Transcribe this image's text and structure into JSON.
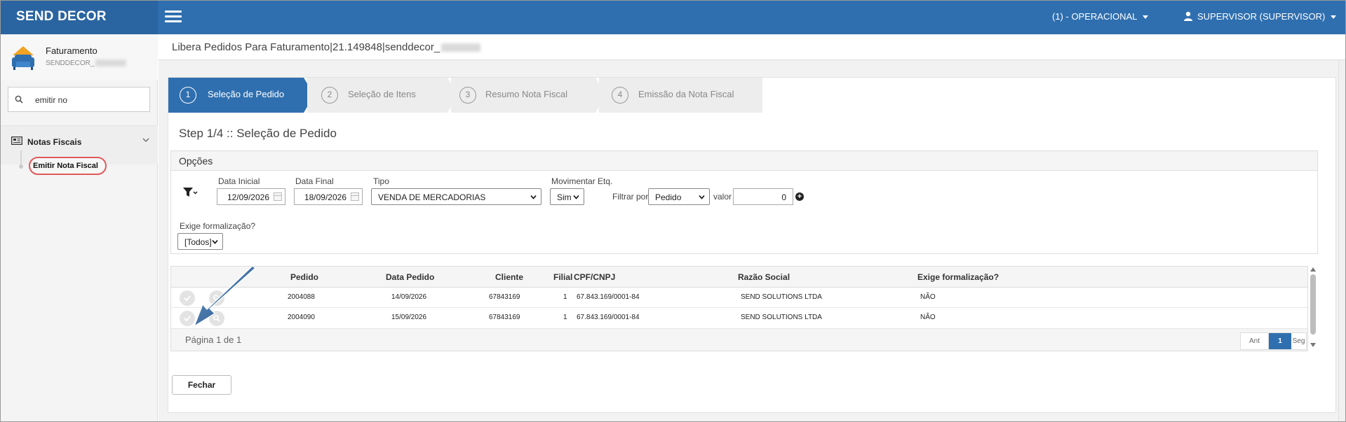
{
  "topbar": {
    "brand": "SEND DECOR",
    "unit": "(1) - OPERACIONAL",
    "user": "SUPERVISOR (SUPERVISOR)",
    "color": "#2f6faf"
  },
  "sidebar": {
    "module_title": "Faturamento",
    "module_sub": "SENDDECOR_",
    "search_value": "emitir no",
    "menu_group": "Notas Fiscais",
    "menu_item": "Emitir Nota Fiscal"
  },
  "page": {
    "title": "Libera Pedidos Para Faturamento|21.149848|senddecor_"
  },
  "wizard": {
    "steps": [
      {
        "num": "1",
        "label": "Seleção de Pedido"
      },
      {
        "num": "2",
        "label": "Seleção de Itens"
      },
      {
        "num": "3",
        "label": "Resumo Nota Fiscal"
      },
      {
        "num": "4",
        "label": "Emissão da Nota Fiscal"
      }
    ],
    "step_title": "Step 1/4 :: Seleção de Pedido"
  },
  "options": {
    "header": "Opções",
    "data_inicial_label": "Data Inicial",
    "data_inicial": "12/09/2026",
    "data_final_label": "Data Final",
    "data_final": "18/09/2026",
    "tipo_label": "Tipo",
    "tipo": "VENDA DE MERCADORIAS",
    "mov_label": "Movimentar Etq.",
    "mov": "Sim",
    "filtrar_label": "Filtrar por",
    "filtrar": "Pedido",
    "valor_label": "valor",
    "valor": "0",
    "exige_label": "Exige formalização?",
    "exige": "[Todos]"
  },
  "grid": {
    "columns": [
      "Pedido",
      "Data Pedido",
      "Cliente",
      "Filial",
      "CPF/CNPJ",
      "Razão Social",
      "Exige formalização?"
    ],
    "rows": [
      {
        "pedido": "2004088",
        "data": "14/09/2026",
        "cliente": "67843169",
        "filial": "1",
        "cnpj": "67.843.169/0001-84",
        "razao": "SEND SOLUTIONS LTDA",
        "exige": "NÃO"
      },
      {
        "pedido": "2004090",
        "data": "15/09/2026",
        "cliente": "67843169",
        "filial": "1",
        "cnpj": "67.843.169/0001-84",
        "razao": "SEND SOLUTIONS LTDA",
        "exige": "NÃO"
      }
    ],
    "page_info": "Página 1 de 1",
    "pager": {
      "prev": "Ant",
      "current": "1",
      "next": "Seg"
    }
  },
  "footer": {
    "close_label": "Fechar"
  }
}
